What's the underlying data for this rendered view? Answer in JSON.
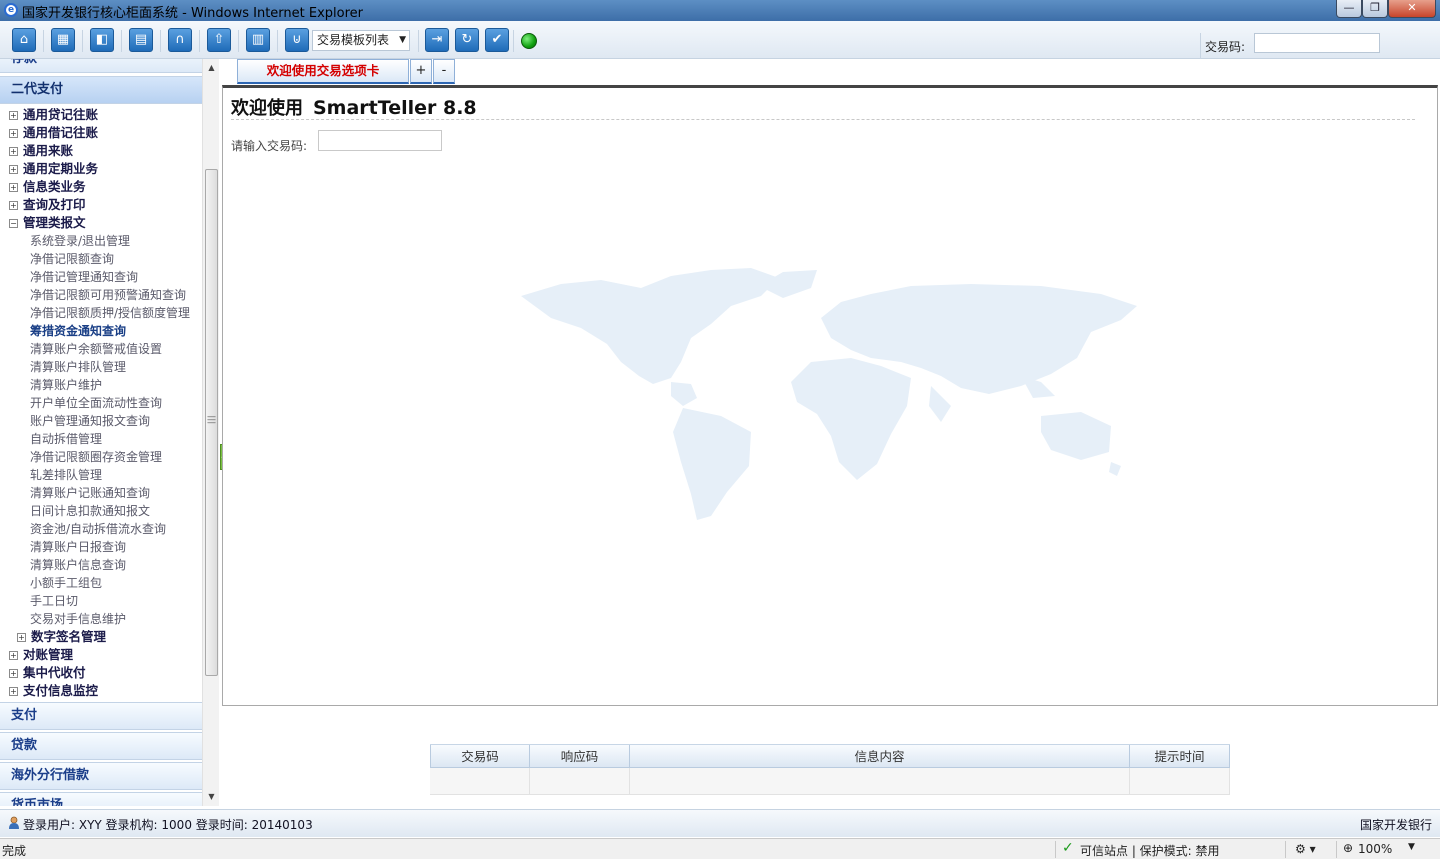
{
  "window": {
    "title": "国家开发银行核心柜面系统 - Windows Internet Explorer",
    "minimize": "—",
    "maximize": "❐",
    "close": "✕"
  },
  "toolbar": {
    "buttons": [
      {
        "icon": "home-icon"
      },
      {
        "icon": "calculator-icon"
      },
      {
        "icon": "back-window-icon"
      },
      {
        "icon": "document-icon"
      },
      {
        "icon": "headset-icon"
      },
      {
        "icon": "upload-icon"
      },
      {
        "icon": "trash-icon"
      },
      {
        "icon": "template-icon"
      },
      {
        "icon": "login-icon"
      },
      {
        "icon": "refresh-icon"
      },
      {
        "icon": "confirm-check-icon"
      }
    ],
    "template_select": "交易模板列表",
    "status_color": "#10a010",
    "txcode_label": "交易码:",
    "txcode_value": ""
  },
  "sidebar": {
    "top_partial": "存款",
    "active_section": "二代支付",
    "groups_before": [
      {
        "label": "通用贷记往账",
        "toggle": "+"
      },
      {
        "label": "通用借记往账",
        "toggle": "+"
      },
      {
        "label": "通用来账",
        "toggle": "+"
      },
      {
        "label": "通用定期业务",
        "toggle": "+"
      },
      {
        "label": "信息类业务",
        "toggle": "+"
      },
      {
        "label": "查询及打印",
        "toggle": "+"
      },
      {
        "label": "管理类报文",
        "toggle": "−"
      }
    ],
    "leaves": [
      "系统登录/退出管理",
      "净借记限额查询",
      "净借记管理通知查询",
      "净借记限额可用预警通知查询",
      "净借记限额质押/授信额度管理",
      "筹措资金通知查询",
      "清算账户余额警戒值设置",
      "清算账户排队管理",
      "清算账户维护",
      "开户单位全面流动性查询",
      "账户管理通知报文查询",
      "自动拆借管理",
      "净借记限额圈存资金管理",
      "轧差排队管理",
      "清算账户记账通知查询",
      "日间计息扣款通知报文",
      "资金池/自动拆借流水查询",
      "清算账户日报查询",
      "清算账户信息查询",
      "小额手工组包",
      "手工日切",
      "交易对手信息维护"
    ],
    "selected_leaf": "筹措资金通知查询",
    "sub_group": {
      "label": "数字签名管理",
      "toggle": "+"
    },
    "groups_after": [
      {
        "label": "对账管理",
        "toggle": "+"
      },
      {
        "label": "集中代收付",
        "toggle": "+"
      },
      {
        "label": "支付信息监控",
        "toggle": "+"
      }
    ],
    "sections_after": [
      "支付",
      "贷款",
      "海外分行借款"
    ],
    "bottom_partial": "货币市场"
  },
  "tabs": {
    "welcome": "欢迎使用交易选项卡",
    "add": "+",
    "remove": "-"
  },
  "welcome": {
    "greeting": "欢迎使用",
    "app_name": "SmartTeller 8.8",
    "prompt_label": "请输入交易码:",
    "prompt_value": ""
  },
  "message_table": {
    "columns": [
      "交易码",
      "响应码",
      "信息内容",
      "提示时间"
    ],
    "rows": [
      [
        "",
        "",
        "",
        ""
      ]
    ]
  },
  "userbar": {
    "user_info": "登录用户: XYY 登录机构: 1000 登录时间: 20140103",
    "bank_name": "国家开发银行"
  },
  "ie_status": {
    "text": "完成",
    "zone": "可信站点 | 保护模式: 禁用",
    "zoom": "100%"
  },
  "colors": {
    "accent": "#1f6bb8",
    "tab_text": "#d40000",
    "section_text": "#1b3e8a",
    "map": "#e6eff8"
  }
}
